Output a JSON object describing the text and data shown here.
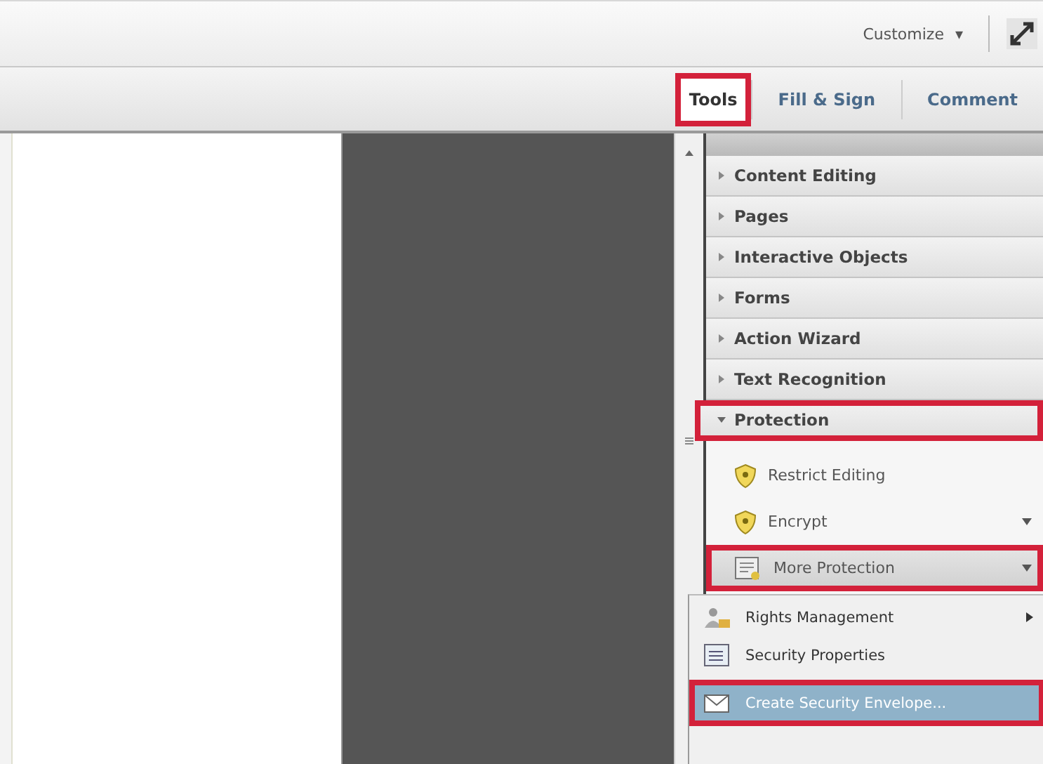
{
  "toolbar": {
    "customize": "Customize",
    "caret": "▾"
  },
  "tabs": [
    {
      "label": "Tools",
      "selected": true,
      "highlighted": true
    },
    {
      "label": "Fill & Sign",
      "selected": false,
      "highlighted": false
    },
    {
      "label": "Comment",
      "selected": false,
      "highlighted": false
    }
  ],
  "panels": [
    {
      "label": "Content Editing",
      "expanded": false,
      "highlighted": false
    },
    {
      "label": "Pages",
      "expanded": false,
      "highlighted": false
    },
    {
      "label": "Interactive Objects",
      "expanded": false,
      "highlighted": false
    },
    {
      "label": "Forms",
      "expanded": false,
      "highlighted": false
    },
    {
      "label": "Action Wizard",
      "expanded": false,
      "highlighted": false
    },
    {
      "label": "Text Recognition",
      "expanded": false,
      "highlighted": false
    },
    {
      "label": "Protection",
      "expanded": true,
      "highlighted": true
    }
  ],
  "protection_tools": [
    {
      "label": "Restrict Editing",
      "kind": "shield",
      "has_menu": false,
      "highlighted": false
    },
    {
      "label": "Encrypt",
      "kind": "shield",
      "has_menu": true,
      "highlighted": false
    },
    {
      "label": "More Protection",
      "kind": "document",
      "has_menu": true,
      "highlighted": true
    }
  ],
  "submenu": [
    {
      "label": "Rights Management",
      "kind": "people",
      "has_submenu": true,
      "selected": false,
      "highlighted": false
    },
    {
      "label": "Security Properties",
      "kind": "properties",
      "has_submenu": false,
      "selected": false,
      "highlighted": false
    },
    {
      "label": "Create Security Envelope...",
      "kind": "envelope",
      "has_submenu": false,
      "selected": true,
      "highlighted": true
    }
  ]
}
